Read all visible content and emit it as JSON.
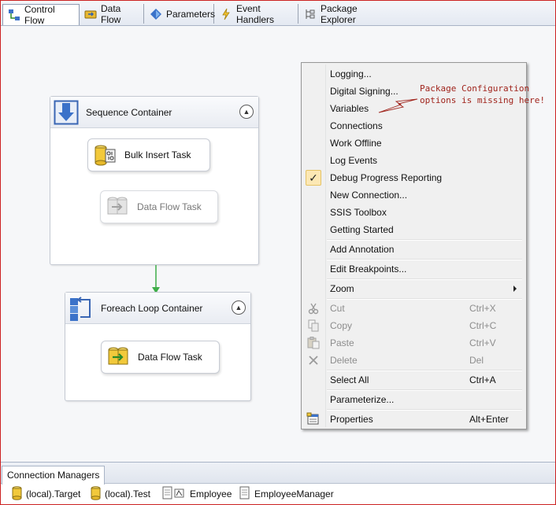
{
  "tabs": [
    {
      "label": "Control Flow",
      "icon": "control-flow-icon",
      "active": true
    },
    {
      "label": "Data Flow",
      "icon": "data-flow-icon",
      "active": false
    },
    {
      "label": "Parameters",
      "icon": "parameters-icon",
      "active": false
    },
    {
      "label": "Event Handlers",
      "icon": "event-handlers-icon",
      "active": false
    },
    {
      "label": "Package Explorer",
      "icon": "package-explorer-icon",
      "active": false
    }
  ],
  "canvas": {
    "sequence_container": {
      "title": "Sequence Container",
      "tasks": [
        {
          "label": "Bulk Insert Task",
          "enabled": true
        },
        {
          "label": "Data Flow Task",
          "enabled": false
        }
      ]
    },
    "foreach_container": {
      "title": "Foreach Loop Container",
      "tasks": [
        {
          "label": "Data Flow Task",
          "enabled": true
        }
      ]
    },
    "precedence_color": "#3fae49"
  },
  "context_menu": {
    "items": [
      {
        "label": "Logging...",
        "shortcut": "",
        "enabled": true
      },
      {
        "label": "Digital Signing...",
        "shortcut": "",
        "enabled": true
      },
      {
        "label": "Variables",
        "shortcut": "",
        "enabled": true
      },
      {
        "label": "Connections",
        "shortcut": "",
        "enabled": true
      },
      {
        "label": "Work Offline",
        "shortcut": "",
        "enabled": true
      },
      {
        "label": "Log Events",
        "shortcut": "",
        "enabled": true
      },
      {
        "label": "Debug Progress Reporting",
        "shortcut": "",
        "enabled": true,
        "checked": true
      },
      {
        "label": "New Connection...",
        "shortcut": "",
        "enabled": true
      },
      {
        "label": "SSIS Toolbox",
        "shortcut": "",
        "enabled": true
      },
      {
        "label": "Getting Started",
        "shortcut": "",
        "enabled": true
      },
      {
        "label": "Add Annotation",
        "shortcut": "",
        "enabled": true
      },
      {
        "label": "Edit Breakpoints...",
        "shortcut": "",
        "enabled": true
      },
      {
        "label": "Zoom",
        "shortcut": "",
        "enabled": true,
        "submenu": true
      },
      {
        "label": "Cut",
        "shortcut": "Ctrl+X",
        "enabled": false,
        "icon": "cut-icon"
      },
      {
        "label": "Copy",
        "shortcut": "Ctrl+C",
        "enabled": false,
        "icon": "copy-icon"
      },
      {
        "label": "Paste",
        "shortcut": "Ctrl+V",
        "enabled": false,
        "icon": "paste-icon"
      },
      {
        "label": "Delete",
        "shortcut": "Del",
        "enabled": false,
        "icon": "delete-icon"
      },
      {
        "label": "Select All",
        "shortcut": "Ctrl+A",
        "enabled": true
      },
      {
        "label": "Parameterize...",
        "shortcut": "",
        "enabled": true
      },
      {
        "label": "Properties",
        "shortcut": "Alt+Enter",
        "enabled": true,
        "icon": "properties-icon"
      }
    ]
  },
  "annotation": {
    "line1": "Package Configuration",
    "line2": "options is missing here!",
    "color": "#a0241c"
  },
  "connection_managers": {
    "tab_label": "Connection Managers",
    "items": [
      {
        "label": "(local).Target",
        "icon": "database-icon"
      },
      {
        "label": "(local).Test",
        "icon": "database-icon"
      },
      {
        "label": "Employee",
        "icon": "flat-file-icon"
      },
      {
        "label": "EmployeeManager",
        "icon": "flat-file-icon"
      }
    ]
  }
}
